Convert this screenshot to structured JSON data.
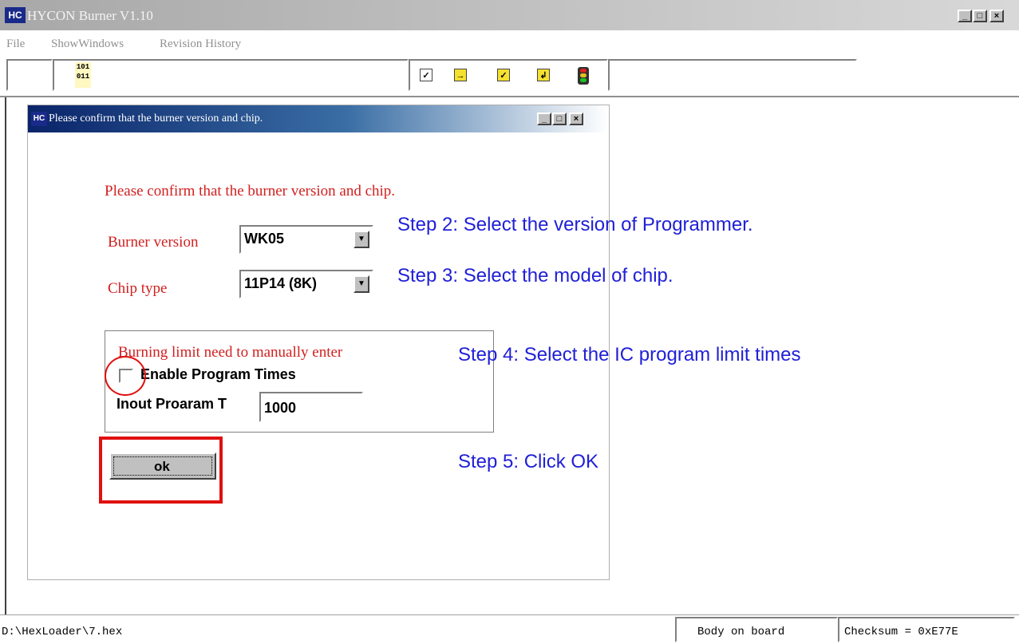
{
  "app": {
    "title": "HYCON Burner V1.10",
    "logo": "HC"
  },
  "menu": {
    "items": [
      "File",
      "ShowWindows",
      "Revision History"
    ]
  },
  "toolbar": {
    "hex_icon_top": "101",
    "hex_icon_bottom": "011",
    "icons": [
      "blank-check-icon",
      "program-icon",
      "verify-icon",
      "read-icon",
      "traffic-light-icon"
    ]
  },
  "window_controls": {
    "minimize": "_",
    "maximize": "□",
    "close": "×"
  },
  "dialog": {
    "title": "Please confirm that the burner version and chip.",
    "heading": "Please confirm that the burner version and chip.",
    "burner_version_label": "Burner version",
    "burner_version_value": "WK05",
    "chip_type_label": "Chip type",
    "chip_type_value": "11P14 (8K)",
    "group_label": "Burning limit need to manually enter",
    "enable_label": "Enable Program Times",
    "enable_checked": false,
    "input_label": "Inout Proaram T",
    "input_value": "1000",
    "ok_label": "ok"
  },
  "annotations": {
    "step2": "Step 2: Select the version of Programmer.",
    "step3": "Step 3: Select the model of chip.",
    "step4": "Step 4: Select the IC program limit times",
    "step5": "Step 5: Click OK"
  },
  "status": {
    "path": "D:\\HexLoader\\7.hex",
    "body": "Body on board",
    "checksum": "Checksum = 0xE77E"
  },
  "colors": {
    "annotation_blue": "#2020d8",
    "label_red": "#d22020",
    "highlight_red": "#e01010",
    "titlebar_active": "#0a246a"
  }
}
